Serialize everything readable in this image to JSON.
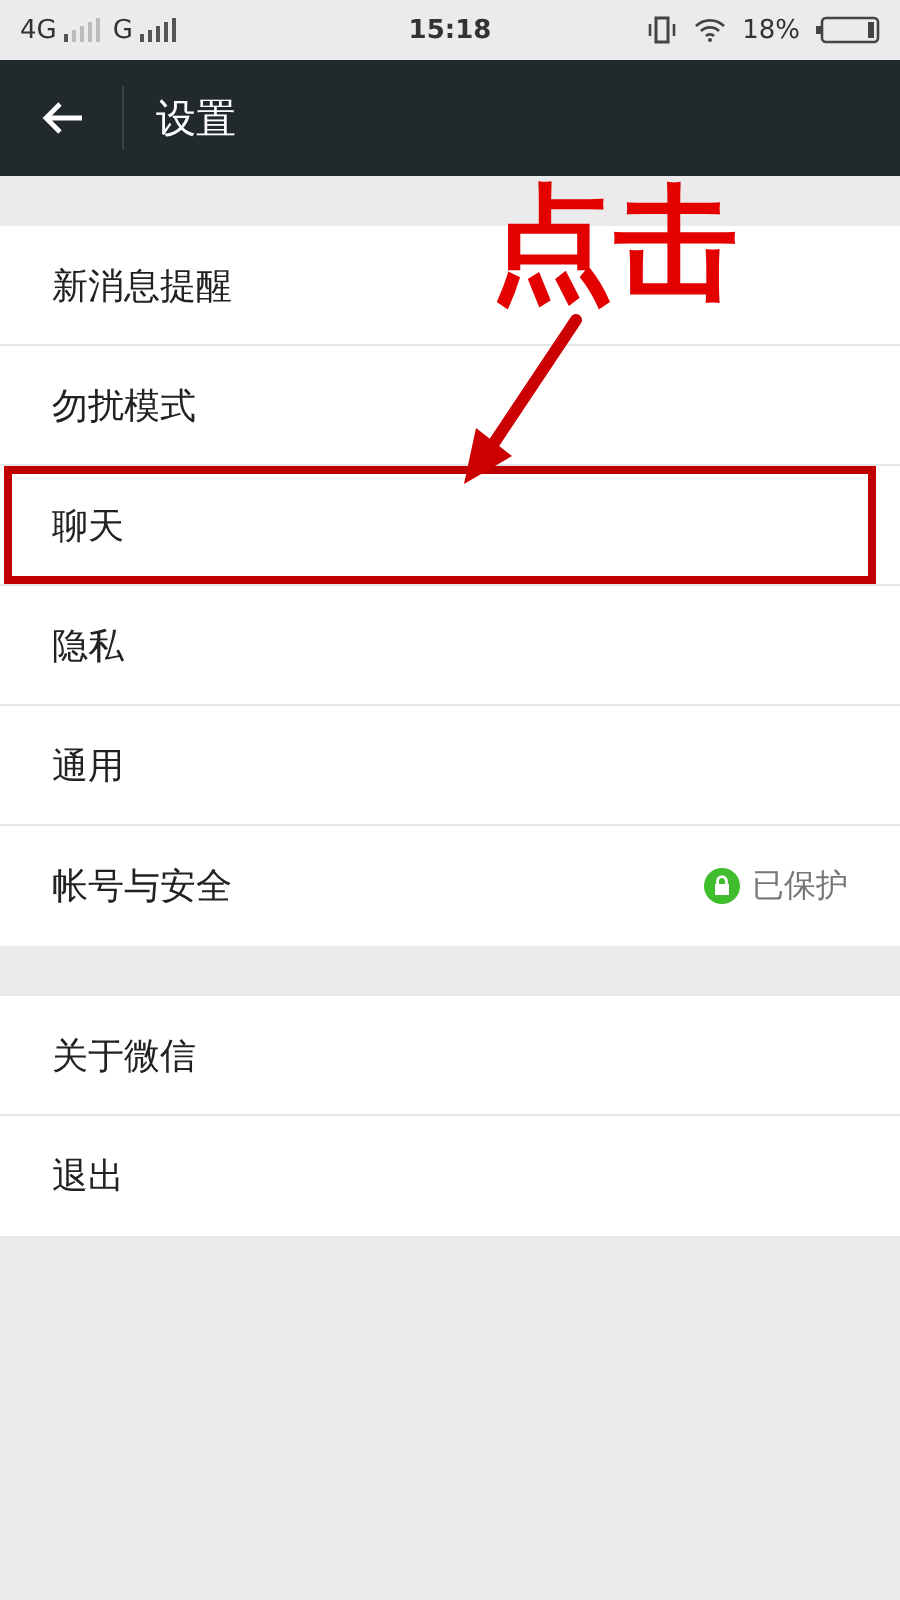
{
  "status_bar": {
    "network_1": "4G",
    "network_2": "G",
    "time": "15:18",
    "battery": "18%"
  },
  "header": {
    "title": "设置"
  },
  "groups": [
    {
      "items": [
        {
          "label": "新消息提醒",
          "highlighted": false
        },
        {
          "label": "勿扰模式",
          "highlighted": false
        },
        {
          "label": "聊天",
          "highlighted": true
        },
        {
          "label": "隐私",
          "highlighted": false
        },
        {
          "label": "通用",
          "highlighted": false
        },
        {
          "label": "帐号与安全",
          "highlighted": false,
          "status": "已保护"
        }
      ]
    },
    {
      "items": [
        {
          "label": "关于微信",
          "highlighted": false
        },
        {
          "label": "退出",
          "highlighted": false
        }
      ]
    }
  ],
  "annotation": {
    "text": "点击"
  }
}
